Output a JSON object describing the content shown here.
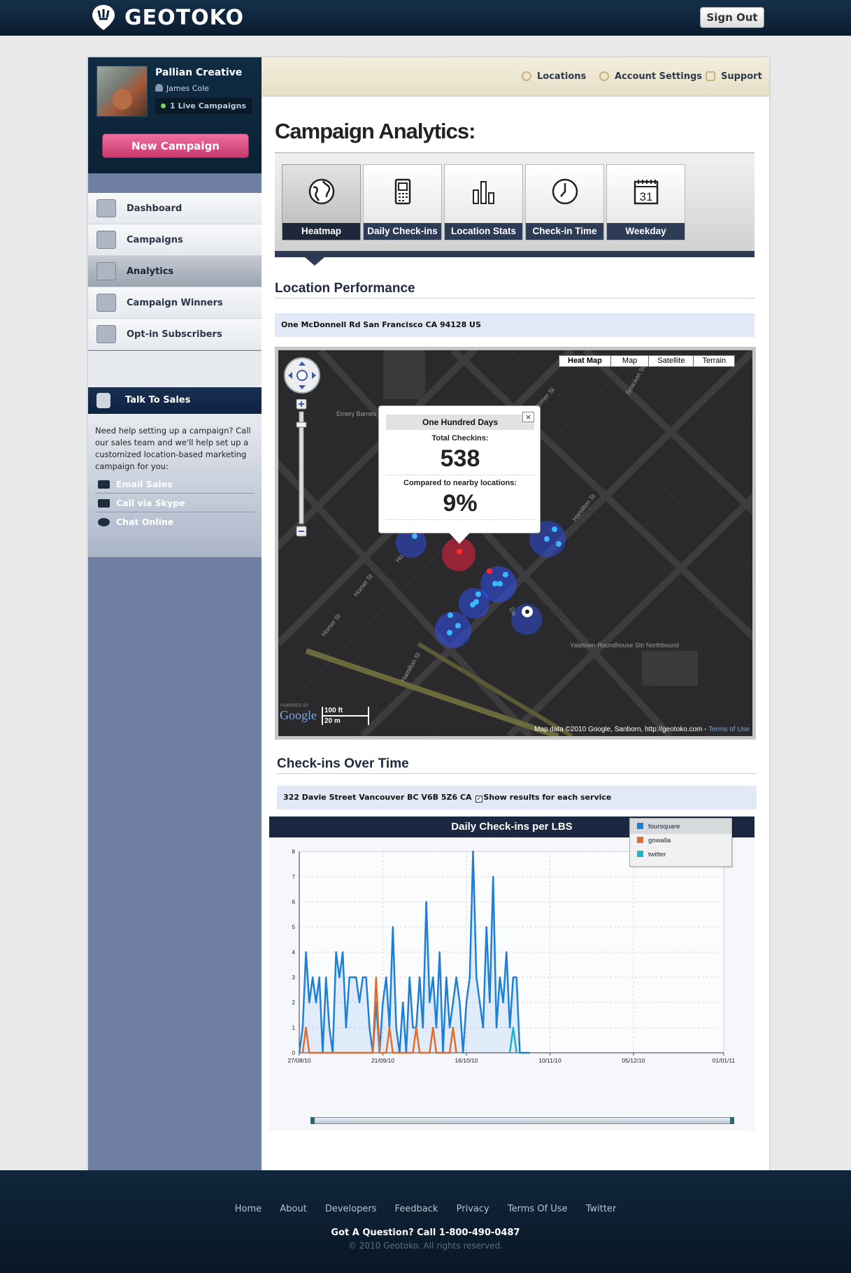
{
  "brand": {
    "name": "GEOTOKO"
  },
  "header": {
    "signout": "Sign Out"
  },
  "profile": {
    "company": "Pallian Creative",
    "user": "James Cole",
    "live": "1 Live Campaigns",
    "new_campaign": "New Campaign"
  },
  "sidebar": {
    "items": [
      {
        "label": "Dashboard",
        "icon": "house-icon"
      },
      {
        "label": "Campaigns",
        "icon": "card-icon"
      },
      {
        "label": "Analytics",
        "icon": "graph-icon",
        "active": true
      },
      {
        "label": "Campaign Winners",
        "icon": "medal-icon"
      },
      {
        "label": "Opt-in Subscribers",
        "icon": "people-icon"
      }
    ],
    "talk": {
      "title": "Talk To Sales",
      "text": "Need help setting up a campaign? Call our sales team and we'll help set up a customized location-based marketing campaign for you:",
      "links": [
        "Email Sales",
        "Call via Skype",
        "Chat Online"
      ]
    }
  },
  "subnav": {
    "locations": "Locations",
    "account": "Account Settings",
    "support": "Support"
  },
  "page": {
    "title": "Campaign Analytics:"
  },
  "tabs": [
    "Heatmap",
    "Daily Check-ins",
    "Location Stats",
    "Check-in Time",
    "Weekday"
  ],
  "tabs_icons": [
    "globe-icon",
    "phone-checkin-icon",
    "bar-chart-icon",
    "clock-icon",
    "calendar-icon"
  ],
  "calendar_day": "31",
  "location_performance": {
    "title": "Location Performance",
    "address": "One McDonnell Rd San Francisco CA 94128 US"
  },
  "map": {
    "types": [
      "Heat Map",
      "Map",
      "Satellite",
      "Terrain"
    ],
    "selected_type": "Heat Map",
    "popup": {
      "title": "One Hundred Days",
      "close": "×",
      "label1": "Total Checkins:",
      "value1": "538",
      "label2": "Compared to nearby locations:",
      "value2": "9%"
    },
    "streets": [
      "Homer St",
      "Hamilton St",
      "Homer St",
      "Homer St",
      "Hamilton St",
      "Smicken St",
      "Ho",
      "Da"
    ],
    "places": [
      "Emery Barnes Park",
      "Yaletown-Roundhouse Stn Northbound"
    ],
    "scale": [
      "100 ft",
      "20 m"
    ],
    "powered": "POWERED BY",
    "google": "Google",
    "credit": "Map data ©2010 Google, Sanborn, http://geotoko.com - ",
    "terms": "Terms of Use"
  },
  "checkins": {
    "title": "Check-ins Over Time",
    "address": "322 Davie Street Vancouver BC V6B 5Z6 CA",
    "checkbox_label": "Show results for each service",
    "checked": true
  },
  "chart_data": {
    "type": "line",
    "title": "Daily Check-ins per LBS",
    "xlabel": "",
    "ylabel": "",
    "ylim": [
      0,
      8
    ],
    "yticks": [
      0,
      1,
      2,
      3,
      4,
      5,
      6,
      7,
      8
    ],
    "xticks": [
      "27/08/10",
      "21/09/10",
      "16/10/10",
      "10/11/10",
      "05/12/10",
      "01/01/11"
    ],
    "x_start": "27/08/10",
    "x_end": "01/01/11",
    "legend": "top-right",
    "series": [
      {
        "name": "foursquare",
        "color": "#1f7fd6",
        "x": [
          "27/08/10",
          "28/08/10",
          "29/08/10",
          "30/08/10",
          "31/08/10",
          "01/09/10",
          "02/09/10",
          "03/09/10",
          "04/09/10",
          "05/09/10",
          "06/09/10",
          "07/09/10",
          "08/09/10",
          "09/09/10",
          "10/09/10",
          "11/09/10",
          "12/09/10",
          "13/09/10",
          "14/09/10",
          "15/09/10",
          "16/09/10",
          "17/09/10",
          "18/09/10",
          "19/09/10",
          "20/09/10",
          "21/09/10",
          "22/09/10",
          "23/09/10",
          "24/09/10",
          "25/09/10",
          "26/09/10",
          "27/09/10",
          "28/09/10",
          "29/09/10",
          "30/09/10",
          "01/10/10",
          "02/10/10",
          "03/10/10",
          "04/10/10",
          "05/10/10",
          "06/10/10",
          "07/10/10",
          "08/10/10",
          "09/10/10",
          "10/10/10",
          "11/10/10",
          "12/10/10",
          "13/10/10",
          "14/10/10",
          "15/10/10",
          "16/10/10",
          "17/10/10",
          "18/10/10",
          "19/10/10",
          "20/10/10",
          "21/10/10",
          "22/10/10",
          "23/10/10",
          "24/10/10",
          "25/10/10",
          "26/10/10",
          "27/10/10",
          "28/10/10",
          "29/10/10",
          "30/10/10",
          "31/10/10",
          "01/11/10",
          "02/11/10",
          "03/11/10",
          "04/11/10"
        ],
        "values": [
          0,
          1,
          4,
          2,
          3,
          2,
          3,
          0,
          3,
          1,
          0,
          4,
          3,
          4,
          1,
          3,
          3,
          3,
          2,
          3,
          3,
          1,
          0,
          2,
          0,
          2,
          3,
          1,
          5,
          1,
          0,
          2,
          0,
          3,
          1,
          1,
          3,
          1,
          6,
          2,
          3,
          1,
          4,
          0,
          3,
          1,
          2,
          3,
          2,
          0,
          2,
          3,
          8,
          3,
          2,
          1,
          5,
          2,
          7,
          1,
          3,
          2,
          4,
          1,
          3,
          3,
          0,
          0,
          0,
          0
        ]
      },
      {
        "name": "gowalla",
        "color": "#e06d2e",
        "x": [
          "28/08/10",
          "29/08/10",
          "30/08/10",
          "18/09/10",
          "19/09/10",
          "20/09/10",
          "22/09/10",
          "23/09/10",
          "24/09/10",
          "30/09/10",
          "01/10/10",
          "02/10/10",
          "05/10/10",
          "06/10/10",
          "07/10/10",
          "11/10/10",
          "12/10/10",
          "13/10/10"
        ],
        "values": [
          0,
          1,
          0,
          0,
          3,
          0,
          0,
          1,
          0,
          0,
          1,
          0,
          0,
          1,
          0,
          0,
          1,
          0
        ]
      },
      {
        "name": "twitter",
        "color": "#1fb3c8",
        "x": [
          "29/10/10",
          "30/10/10",
          "31/10/10"
        ],
        "values": [
          0,
          1,
          0
        ]
      }
    ]
  },
  "footer": {
    "links": [
      "Home",
      "About",
      "Developers",
      "Feedback",
      "Privacy",
      "Terms Of Use",
      "Twitter"
    ],
    "question": "Got A Question? Call 1-800-490-0487",
    "copyright": "© 2010 Geotoko. All rights reserved."
  }
}
